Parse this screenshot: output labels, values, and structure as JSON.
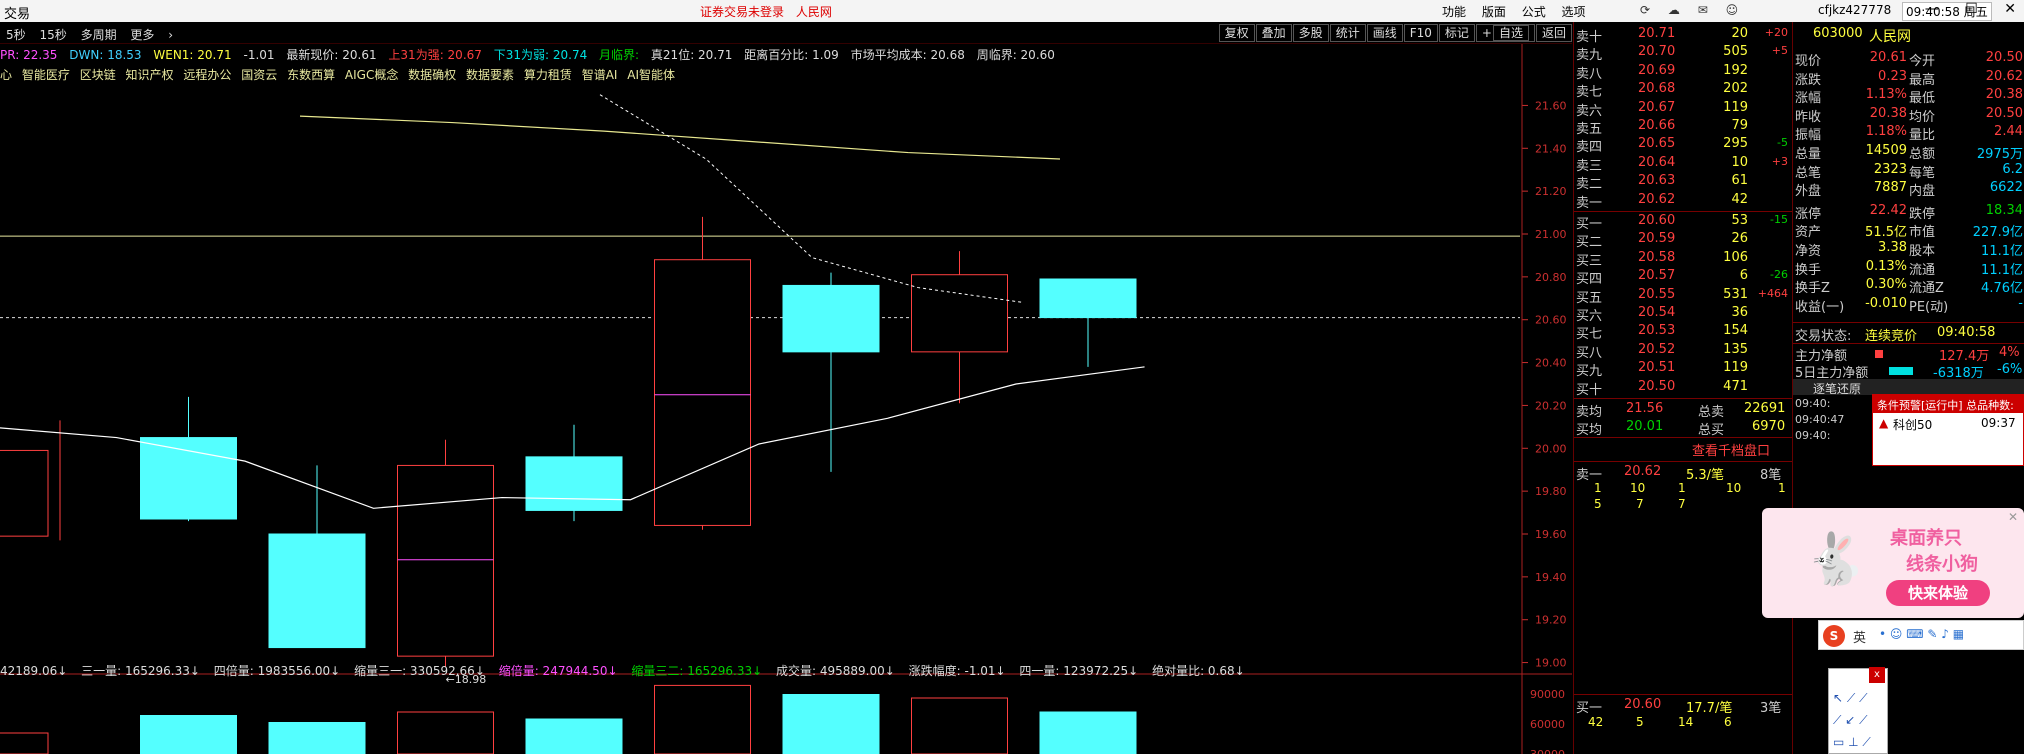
{
  "titlebar": {
    "app": "交易",
    "notice_login": "证券交易未登录",
    "notice_site": "人民网",
    "menu": [
      "功能",
      "版面",
      "公式",
      "选项"
    ],
    "user": "cfjkz427778",
    "clock": "09:40:58 周五"
  },
  "chartbar": {
    "left": [
      "5秒",
      "15秒",
      "多周期",
      "更多"
    ],
    "right": [
      "复权",
      "叠加",
      "多股",
      "统计",
      "画线",
      "F10",
      "标记",
      "自选",
      "返回"
    ]
  },
  "indicators": {
    "up": "PR: 22.35",
    "dwn": "DWN: 18.53",
    "wen": "WEN1: 20.71",
    "change": "-1.01",
    "latest": "最新现价: 20.61",
    "cross_up": "上31为强: 20.67",
    "cross_dn": "下31为弱: 20.74",
    "month": "月临界:",
    "true21": "真21位: 20.71",
    "pct": "距离百分比: 1.09",
    "cost": "市场平均成本: 20.68",
    "week": "周临界: 20.60"
  },
  "concepts": [
    "心",
    "智能医疗",
    "区块链",
    "知识产权",
    "远程办公",
    "国资云",
    "东数西算",
    "AIGC概念",
    "数据确权",
    "数据要素",
    "算力租赁",
    "智谱AI",
    "AI智能体"
  ],
  "chart_data": {
    "type": "candlestick",
    "y_ticks": [
      "21.60",
      "21.40",
      "21.20",
      "21.00",
      "20.80",
      "20.60",
      "20.40",
      "20.20",
      "20.00",
      "19.80",
      "19.60",
      "19.40",
      "19.20",
      "19.00"
    ],
    "ylim": [
      18.9,
      21.7
    ],
    "candles": [
      {
        "open": 19.99,
        "close": 19.59,
        "high": 20.13,
        "low": 19.57,
        "bull": false
      },
      {
        "open": 19.67,
        "close": 20.05,
        "high": 20.24,
        "low": 19.66,
        "bull": true
      },
      {
        "open": 19.6,
        "close": 19.07,
        "high": 19.92,
        "low": 19.07,
        "bull": false
      },
      {
        "open": 19.92,
        "close": 19.03,
        "high": 20.04,
        "low": 18.98,
        "bull": true,
        "mid": 19.48
      },
      {
        "open": 19.71,
        "close": 19.96,
        "high": 20.11,
        "low": 19.66,
        "bull": true
      },
      {
        "open": 19.64,
        "close": 20.88,
        "high": 21.08,
        "low": 19.62,
        "bull": true,
        "mid": 20.25
      },
      {
        "open": 20.45,
        "close": 20.76,
        "high": 20.82,
        "low": 19.89,
        "bull": true
      },
      {
        "open": 20.81,
        "close": 20.45,
        "high": 20.92,
        "low": 20.21,
        "bull": false
      },
      {
        "open": 20.61,
        "close": 20.79,
        "high": 20.79,
        "low": 20.38,
        "bull": true
      }
    ],
    "ma_white": [
      20.1,
      20.05,
      19.94,
      19.72,
      19.77,
      19.76,
      20.02,
      20.14,
      20.3,
      20.38
    ],
    "ma_yellow_y": [
      21.55,
      21.52,
      21.48,
      21.43,
      21.38,
      21.35
    ],
    "ma_dashed": [
      21.65,
      21.35,
      20.89,
      20.75,
      20.68
    ],
    "ref_line_solid": 20.99,
    "ref_line_dashed": 20.61,
    "low_label": "18.98"
  },
  "volume": {
    "labels": [
      "42189.06↓",
      "三一量: 165296.33↓",
      "四倍量: 1983556.00↓",
      "缩量三一: 330592.66↓",
      "缩倍量: 247944.50↓",
      "缩量三二: 165296.33↓",
      "成交量: 495889.00↓",
      "涨跌幅度: -1.01↓",
      "四一量: 123972.25↓",
      "绝对量比: 0.68↓"
    ],
    "y_ticks": [
      "90000",
      "60000",
      "30000"
    ],
    "bars": [
      0.3,
      0.55,
      0.45,
      0.6,
      0.5,
      0.98,
      0.85,
      0.8,
      0.6
    ]
  },
  "book": {
    "asks": [
      {
        "label": "卖十",
        "price": "20.71",
        "vol": "20",
        "chg": "+20"
      },
      {
        "label": "卖九",
        "price": "20.70",
        "vol": "505",
        "chg": "+5"
      },
      {
        "label": "卖八",
        "price": "20.69",
        "vol": "192",
        "chg": ""
      },
      {
        "label": "卖七",
        "price": "20.68",
        "vol": "202",
        "chg": ""
      },
      {
        "label": "卖六",
        "price": "20.67",
        "vol": "119",
        "chg": ""
      },
      {
        "label": "卖五",
        "price": "20.66",
        "vol": "79",
        "chg": ""
      },
      {
        "label": "卖四",
        "price": "20.65",
        "vol": "295",
        "chg": "-5"
      },
      {
        "label": "卖三",
        "price": "20.64",
        "vol": "10",
        "chg": "+3"
      },
      {
        "label": "卖二",
        "price": "20.63",
        "vol": "61",
        "chg": ""
      },
      {
        "label": "卖一",
        "price": "20.62",
        "vol": "42",
        "chg": ""
      }
    ],
    "bids": [
      {
        "label": "买一",
        "price": "20.60",
        "vol": "53",
        "chg": "-15"
      },
      {
        "label": "买二",
        "price": "20.59",
        "vol": "26",
        "chg": ""
      },
      {
        "label": "买三",
        "price": "20.58",
        "vol": "106",
        "chg": ""
      },
      {
        "label": "买四",
        "price": "20.57",
        "vol": "6",
        "chg": "-26"
      },
      {
        "label": "买五",
        "price": "20.55",
        "vol": "531",
        "chg": "+464"
      },
      {
        "label": "买六",
        "price": "20.54",
        "vol": "36",
        "chg": ""
      },
      {
        "label": "买七",
        "price": "20.53",
        "vol": "154",
        "chg": ""
      },
      {
        "label": "买八",
        "price": "20.52",
        "vol": "135",
        "chg": ""
      },
      {
        "label": "买九",
        "price": "20.51",
        "vol": "119",
        "chg": ""
      },
      {
        "label": "买十",
        "price": "20.50",
        "vol": "471",
        "chg": ""
      }
    ],
    "avg_sell": "21.56",
    "total_sell": "22691",
    "avg_buy": "20.01",
    "total_buy": "6970",
    "avg_sell_label": "卖均",
    "avg_buy_label": "买均",
    "total_sell_label": "总卖",
    "total_buy_label": "总买",
    "depth_link": "查看千档盘口",
    "sell1_label": "卖一",
    "sell1_price": "20.62",
    "sell1_avg": "5.3/笔",
    "sell1_cnt": "8笔",
    "sell1_q": [
      "1",
      "10",
      "1",
      "10",
      "1"
    ],
    "sell1_q2": [
      "5",
      "7",
      "7"
    ],
    "buy1_label": "买一",
    "buy1_price": "20.60",
    "buy1_avg": "17.7/笔",
    "buy1_cnt": "3笔",
    "buy1_q": [
      "42",
      "5",
      "14",
      "6"
    ]
  },
  "quote": {
    "code": "603000",
    "name": "人民网",
    "rows": [
      {
        "l1": "现价",
        "v1": "20.61",
        "l2": "今开",
        "v2": "20.50"
      },
      {
        "l1": "涨跌",
        "v1": "0.23",
        "l2": "最高",
        "v2": "20.62"
      },
      {
        "l1": "涨幅",
        "v1": "1.13%",
        "l2": "最低",
        "v2": "20.38"
      },
      {
        "l1": "昨收",
        "v1": "20.38",
        "l2": "均价",
        "v2": "20.50"
      },
      {
        "l1": "振幅",
        "v1": "1.18%",
        "l2": "量比",
        "v2": "2.44"
      },
      {
        "l1": "总量",
        "v1": "14509",
        "l2": "总额",
        "v2": "2975万"
      },
      {
        "l1": "总笔",
        "v1": "2323",
        "l2": "每笔",
        "v2": "6.2"
      },
      {
        "l1": "外盘",
        "v1": "7887",
        "l2": "内盘",
        "v2": "6622"
      },
      {
        "l1": "涨停",
        "v1": "22.42",
        "l2": "跌停",
        "v2": "18.34"
      },
      {
        "l1": "资产",
        "v1": "51.5亿",
        "l2": "市值",
        "v2": "227.9亿"
      },
      {
        "l1": "净资",
        "v1": "3.38",
        "l2": "股本",
        "v2": "11.1亿"
      },
      {
        "l1": "换手",
        "v1": "0.13%",
        "l2": "流通",
        "v2": "11.1亿"
      },
      {
        "l1": "换手Z",
        "v1": "0.30%",
        "l2": "流通Z",
        "v2": "4.76亿"
      },
      {
        "l1": "收益(一)",
        "v1": "-0.010",
        "l2": "PE(动)",
        "v2": "-"
      }
    ],
    "status_label": "交易状态:",
    "status": "连续竞价",
    "status_time": "09:40:58",
    "main_flow_label": "主力净额",
    "main_flow": "127.4万",
    "main_flow_pct": "4%",
    "flow5_label": "5日主力净额",
    "flow5": "-6318万",
    "flow5_pct": "-6%",
    "ticker_title": "逐笔还原",
    "ticks": [
      "09:40:",
      "09:40:47",
      "09:40:"
    ]
  },
  "popup": {
    "title": "条件预警[运行中] 总品种数:",
    "item": "科创50",
    "time": "09:37"
  },
  "ad": {
    "line1": "桌面养只",
    "line2": "线条小狗",
    "cta": "快来体验"
  },
  "ime": {
    "label": "英"
  }
}
